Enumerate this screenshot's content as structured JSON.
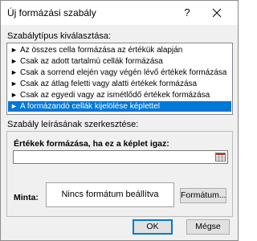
{
  "window": {
    "title": "Új formázási szabály",
    "help_glyph": "?"
  },
  "rule_type": {
    "heading": "Szabálytípus kiválasztása:",
    "items": [
      {
        "label": "Az összes cella formázása az értékük alapján",
        "selected": false
      },
      {
        "label": "Csak az adott tartalmú cellák formázása",
        "selected": false
      },
      {
        "label": "Csak a sorrend elején vagy végén lévő értékek formázása",
        "selected": false
      },
      {
        "label": "Csak az átlag feletti vagy alatti értékek formázása",
        "selected": false
      },
      {
        "label": "Csak az egyedi vagy az ismétlődő értékek formázása",
        "selected": false
      },
      {
        "label": "A formázandó cellák kijelölése képlettel",
        "selected": true
      }
    ],
    "item_glyph": "►"
  },
  "edit": {
    "heading": "Szabály leírásának szerkesztése:",
    "formula_label": "Értékek formázása, ha ez a képlet igaz:",
    "formula_value": "",
    "preview_label": "Minta:",
    "preview_text": "Nincs formátum beállítva",
    "format_button": "Formátum..."
  },
  "buttons": {
    "ok": "OK",
    "cancel": "Mégse"
  },
  "colors": {
    "selection": "#0078d7",
    "dialog_bg": "#f0f0f0"
  }
}
